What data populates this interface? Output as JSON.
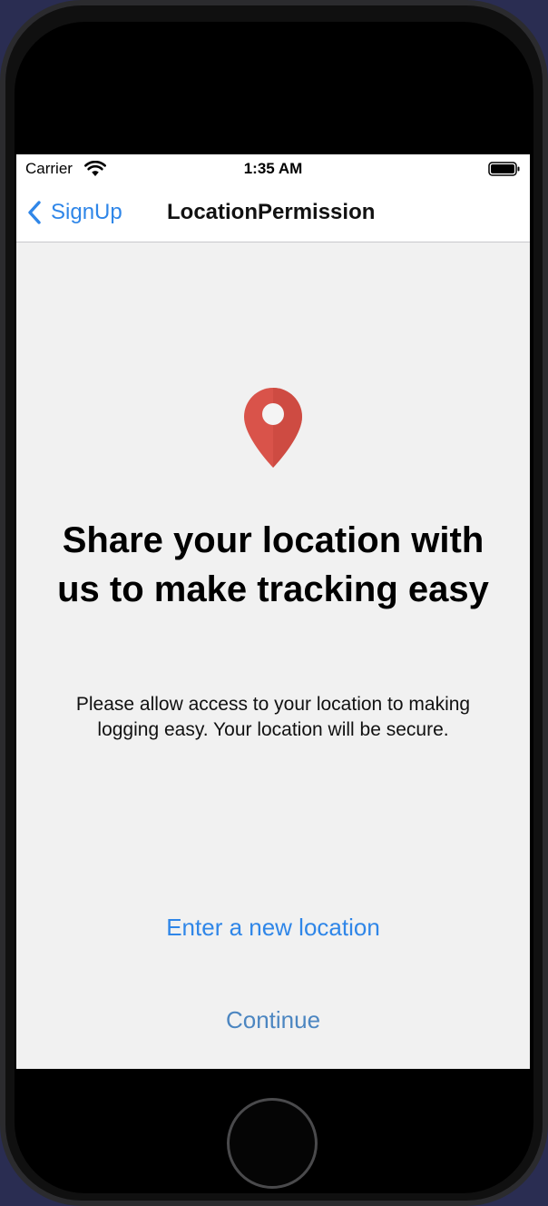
{
  "status_bar": {
    "carrier": "Carrier",
    "time": "1:35 AM"
  },
  "nav": {
    "back_label": "SignUp",
    "title": "LocationPermission"
  },
  "content": {
    "icon": "location-pin-icon",
    "headline": "Share your location with us to make tracking easy",
    "body": "Please allow access to your location to making logging easy. Your location will be secure.",
    "enter_location_label": "Enter a new location",
    "continue_label": "Continue"
  },
  "colors": {
    "tint": "#2f86e8",
    "continue_tint": "#4c86c1",
    "pin": "#d9534a",
    "background": "#f1f1f1"
  }
}
